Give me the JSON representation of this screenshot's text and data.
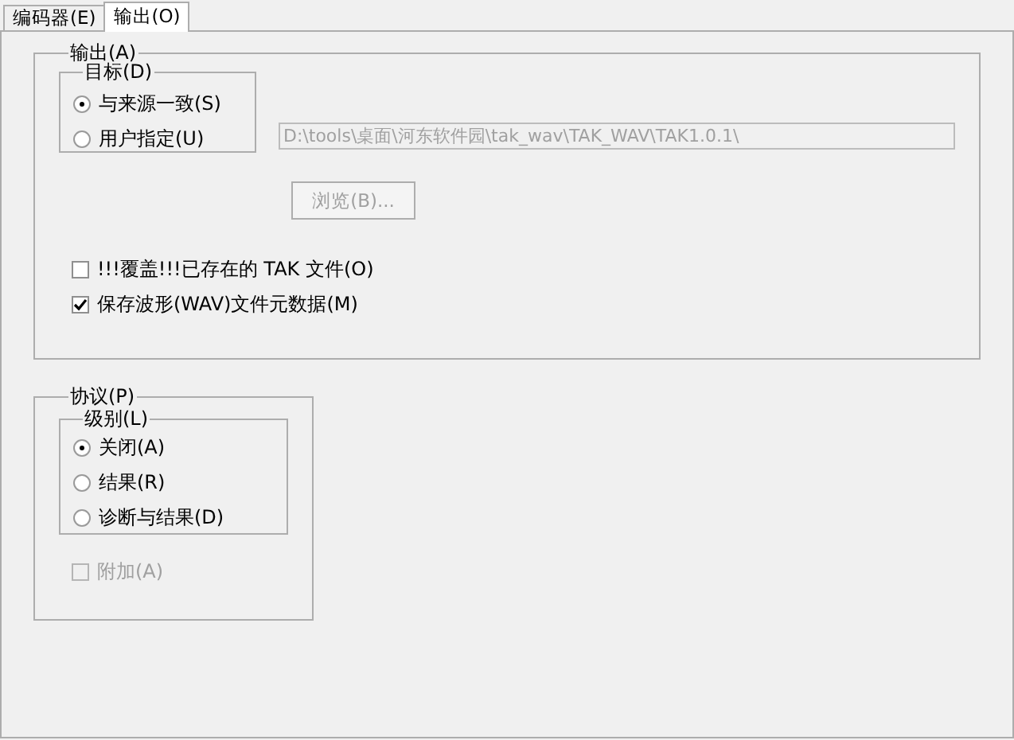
{
  "tabs": [
    {
      "label": "编码器(E)",
      "selected": false
    },
    {
      "label": "输出(O)",
      "selected": true
    }
  ],
  "output_group": {
    "title": "输出(A)",
    "target_group": {
      "title": "目标(D)",
      "options": [
        {
          "label": "与来源一致(S)",
          "selected": true
        },
        {
          "label": "用户指定(U)",
          "selected": false
        }
      ]
    },
    "path_field": {
      "value": "D:\\tools\\桌面\\河东软件园\\tak_wav\\TAK_WAV\\TAK1.0.1\\",
      "disabled": true
    },
    "browse_button": {
      "label": "浏览(B)...",
      "disabled": true
    },
    "checkboxes": [
      {
        "label": "!!!覆盖!!!已存在的 TAK 文件(O)",
        "checked": false,
        "disabled": false
      },
      {
        "label": "保存波形(WAV)文件元数据(M)",
        "checked": true,
        "disabled": false
      }
    ]
  },
  "protocol_group": {
    "title": "协议(P)",
    "level_group": {
      "title": "级别(L)",
      "options": [
        {
          "label": "关闭(A)",
          "selected": true
        },
        {
          "label": "结果(R)",
          "selected": false
        },
        {
          "label": "诊断与结果(D)",
          "selected": false
        }
      ]
    },
    "append_checkbox": {
      "label": "附加(A)",
      "checked": false,
      "disabled": true
    }
  }
}
